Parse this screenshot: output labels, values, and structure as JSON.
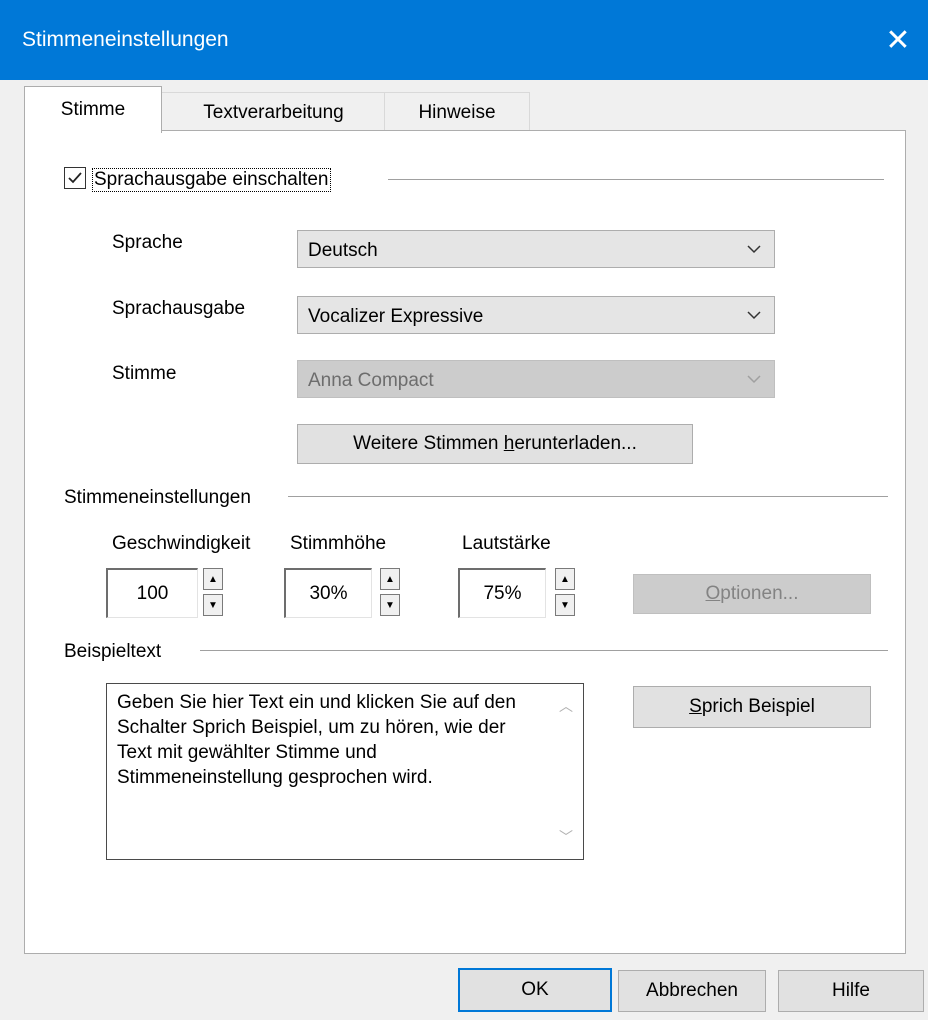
{
  "window": {
    "title": "Stimmeneinstellungen",
    "close": "✕"
  },
  "tabs": [
    {
      "label": "Stimme"
    },
    {
      "label": "Textverarbeitung"
    },
    {
      "label": "Hinweise"
    }
  ],
  "speech_output": {
    "checkbox_label": "Sprachausgabe einschalten",
    "checked": true
  },
  "fields": {
    "language": {
      "label": "Sprache",
      "value": "Deutsch"
    },
    "engine": {
      "label": "Sprachausgabe",
      "value": "Vocalizer Expressive"
    },
    "voice": {
      "label": "Stimme",
      "value": "Anna Compact"
    }
  },
  "download_button": {
    "pre": "Weitere Stimmen ",
    "accel": "h",
    "post": "erunterladen..."
  },
  "voice_settings": {
    "group_label": "Stimmeneinstellungen",
    "speed": {
      "label": "Geschwindigkeit",
      "value": "100"
    },
    "pitch": {
      "label": "Stimmhöhe",
      "value": "30%"
    },
    "volume": {
      "label": "Lautstärke",
      "value": "75%"
    },
    "options_button": {
      "accel": "O",
      "post": "ptionen..."
    }
  },
  "sample": {
    "group_label": "Beispieltext",
    "text": "Geben Sie hier Text ein und klicken Sie auf den Schalter Sprich Beispiel, um zu hören, wie der Text mit gewählter Stimme und Stimmeneinstellung gesprochen wird.",
    "speak_button": {
      "accel": "S",
      "post": "prich Beispiel"
    }
  },
  "footer": {
    "ok": "OK",
    "cancel": "Abbrechen",
    "help": "Hilfe"
  }
}
